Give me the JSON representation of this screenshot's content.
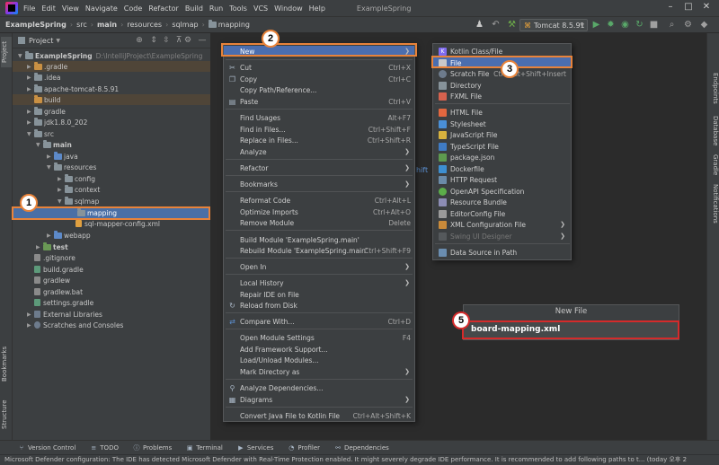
{
  "menu": {
    "items": [
      "File",
      "Edit",
      "View",
      "Navigate",
      "Code",
      "Refactor",
      "Build",
      "Run",
      "Tools",
      "VCS",
      "Window",
      "Help"
    ],
    "window_title": "ExampleSpring"
  },
  "breadcrumb": [
    "ExampleSpring",
    "src",
    "main",
    "resources",
    "sqlmap",
    "mapping"
  ],
  "toolbar": {
    "run_config": "Tomcat 8.5.91"
  },
  "left_stripe": {
    "project": "Project",
    "bookmarks": "Bookmarks",
    "structure": "Structure"
  },
  "right_stripe": {
    "endpoints": "Endpoints",
    "database": "Database",
    "gradle": "Gradle",
    "notifications": "Notifications"
  },
  "project_panel": {
    "title": "Project",
    "tree": [
      {
        "label": "ExampleSpring",
        "path": "D:\\IntelliJProject\\ExampleSpring"
      },
      {
        "label": ".gradle"
      },
      {
        "label": ".idea"
      },
      {
        "label": "apache-tomcat-8.5.91"
      },
      {
        "label": "build"
      },
      {
        "label": "gradle"
      },
      {
        "label": "jdk1.8.0_202"
      },
      {
        "label": "src"
      },
      {
        "label": "main"
      },
      {
        "label": "java"
      },
      {
        "label": "resources"
      },
      {
        "label": "config"
      },
      {
        "label": "context"
      },
      {
        "label": "sqlmap"
      },
      {
        "label": "mapping"
      },
      {
        "label": "sql-mapper-config.xml"
      },
      {
        "label": "webapp"
      },
      {
        "label": "test"
      },
      {
        "label": ".gitignore"
      },
      {
        "label": "build.gradle"
      },
      {
        "label": "gradlew"
      },
      {
        "label": "gradlew.bat"
      },
      {
        "label": "settings.gradle"
      },
      {
        "label": "External Libraries"
      },
      {
        "label": "Scratches and Consoles"
      }
    ]
  },
  "context_menu": {
    "items": [
      {
        "label": "New",
        "shortcut": ""
      },
      {
        "label": "Cut",
        "shortcut": "Ctrl+X"
      },
      {
        "label": "Copy",
        "shortcut": "Ctrl+C"
      },
      {
        "label": "Copy Path/Reference...",
        "shortcut": ""
      },
      {
        "label": "Paste",
        "shortcut": "Ctrl+V"
      },
      {
        "label": "Find Usages",
        "shortcut": "Alt+F7"
      },
      {
        "label": "Find in Files...",
        "shortcut": "Ctrl+Shift+F"
      },
      {
        "label": "Replace in Files...",
        "shortcut": "Ctrl+Shift+R"
      },
      {
        "label": "Analyze",
        "shortcut": ""
      },
      {
        "label": "Refactor",
        "shortcut": ""
      },
      {
        "label": "Bookmarks",
        "shortcut": ""
      },
      {
        "label": "Reformat Code",
        "shortcut": "Ctrl+Alt+L"
      },
      {
        "label": "Optimize Imports",
        "shortcut": "Ctrl+Alt+O"
      },
      {
        "label": "Remove Module",
        "shortcut": "Delete"
      },
      {
        "label": "Build Module 'ExampleSpring.main'",
        "shortcut": ""
      },
      {
        "label": "Rebuild Module 'ExampleSpring.main'",
        "shortcut": "Ctrl+Shift+F9"
      },
      {
        "label": "Open In",
        "shortcut": ""
      },
      {
        "label": "Local History",
        "shortcut": ""
      },
      {
        "label": "Repair IDE on File",
        "shortcut": ""
      },
      {
        "label": "Reload from Disk",
        "shortcut": ""
      },
      {
        "label": "Compare With...",
        "shortcut": "Ctrl+D"
      },
      {
        "label": "Open Module Settings",
        "shortcut": "F4"
      },
      {
        "label": "Add Framework Support...",
        "shortcut": ""
      },
      {
        "label": "Load/Unload Modules...",
        "shortcut": ""
      },
      {
        "label": "Mark Directory as",
        "shortcut": ""
      },
      {
        "label": "Analyze Dependencies...",
        "shortcut": ""
      },
      {
        "label": "Diagrams",
        "shortcut": ""
      },
      {
        "label": "Convert Java File to Kotlin File",
        "shortcut": "Ctrl+Alt+Shift+K"
      }
    ]
  },
  "new_submenu": {
    "items": [
      {
        "label": "Kotlin Class/File",
        "shortcut": ""
      },
      {
        "label": "File",
        "shortcut": ""
      },
      {
        "label": "Scratch File",
        "shortcut": "Ctrl+Alt+Shift+Insert"
      },
      {
        "label": "Directory",
        "shortcut": ""
      },
      {
        "label": "FXML File",
        "shortcut": ""
      },
      {
        "label": "HTML File",
        "shortcut": ""
      },
      {
        "label": "Stylesheet",
        "shortcut": ""
      },
      {
        "label": "JavaScript File",
        "shortcut": ""
      },
      {
        "label": "TypeScript File",
        "shortcut": ""
      },
      {
        "label": "package.json",
        "shortcut": ""
      },
      {
        "label": "Dockerfile",
        "shortcut": ""
      },
      {
        "label": "HTTP Request",
        "shortcut": ""
      },
      {
        "label": "OpenAPI Specification",
        "shortcut": ""
      },
      {
        "label": "Resource Bundle",
        "shortcut": ""
      },
      {
        "label": "EditorConfig File",
        "shortcut": ""
      },
      {
        "label": "XML Configuration File",
        "shortcut": ""
      },
      {
        "label": "Swing UI Designer",
        "shortcut": ""
      },
      {
        "label": "Data Source in Path",
        "shortcut": ""
      }
    ]
  },
  "editor_hint": "hift",
  "new_file_dialog": {
    "title": "New File",
    "value": "board-mapping.xml"
  },
  "callouts": [
    "1",
    "2",
    "3",
    "5"
  ],
  "bottom_tools": [
    "Version Control",
    "TODO",
    "Problems",
    "Terminal",
    "Services",
    "Profiler",
    "Dependencies"
  ],
  "status_bar": "Microsoft Defender configuration: The IDE has detected Microsoft Defender with Real-Time Protection enabled. It might severely degrade IDE performance. It is recommended to add following paths to t... (today 오후 2",
  "colors": {
    "accent": "#4b6eaf",
    "callout_orange": "#e8833a",
    "callout_red": "#d42b2b",
    "background": "#2b2b2b",
    "panel": "#3c3f41"
  }
}
